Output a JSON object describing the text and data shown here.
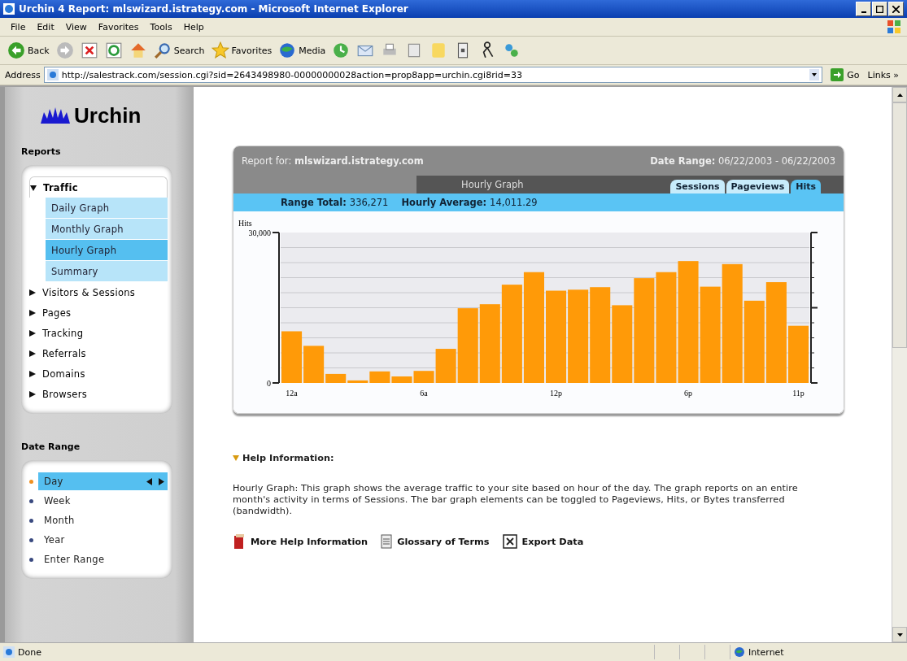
{
  "window": {
    "title": "Urchin 4 Report: mlswizard.istrategy.com - Microsoft Internet Explorer"
  },
  "menu": [
    "File",
    "Edit",
    "View",
    "Favorites",
    "Tools",
    "Help"
  ],
  "toolbar": [
    {
      "kind": "back",
      "label": "Back"
    },
    {
      "kind": "forward"
    },
    {
      "kind": "stop"
    },
    {
      "kind": "refresh"
    },
    {
      "kind": "home"
    },
    {
      "kind": "search",
      "label": "Search"
    },
    {
      "kind": "favorites",
      "label": "Favorites"
    },
    {
      "kind": "media",
      "label": "Media"
    },
    {
      "kind": "history"
    },
    {
      "kind": "mail"
    },
    {
      "kind": "print"
    },
    {
      "kind": "edit"
    },
    {
      "kind": "note"
    },
    {
      "kind": "phone"
    },
    {
      "kind": "messenger"
    },
    {
      "kind": "network"
    }
  ],
  "address": {
    "label": "Address",
    "url": "http://salestrack.com/session.cgi?sid=2643498980-00000000028action=prop8app=urchin.cgi8rid=33",
    "go": "Go",
    "links": "Links »"
  },
  "sidebar": {
    "logo": "Urchin",
    "reports_title": "Reports",
    "reports": [
      {
        "label": "Traffic",
        "expanded": true,
        "children": [
          {
            "label": "Daily Graph",
            "selected": false
          },
          {
            "label": "Monthly Graph",
            "selected": false
          },
          {
            "label": "Hourly Graph",
            "selected": true
          },
          {
            "label": "Summary",
            "selected": false
          }
        ]
      },
      {
        "label": "Visitors & Sessions",
        "expanded": false
      },
      {
        "label": "Pages",
        "expanded": false
      },
      {
        "label": "Tracking",
        "expanded": false
      },
      {
        "label": "Referrals",
        "expanded": false
      },
      {
        "label": "Domains",
        "expanded": false
      },
      {
        "label": "Browsers",
        "expanded": false
      }
    ],
    "date_range_title": "Date Range",
    "date_range": [
      {
        "label": "Day",
        "selected": true
      },
      {
        "label": "Week",
        "selected": false
      },
      {
        "label": "Month",
        "selected": false
      },
      {
        "label": "Year",
        "selected": false
      },
      {
        "label": "Enter Range",
        "selected": false
      }
    ]
  },
  "report": {
    "report_for_label": "Report for:",
    "site": "mlswizard.istrategy.com",
    "date_range_label": "Date Range:",
    "date_range": "06/22/2003 - 06/22/2003",
    "view_title": "Hourly Graph",
    "tabs": [
      {
        "label": "Sessions",
        "selected": false
      },
      {
        "label": "Pageviews",
        "selected": false
      },
      {
        "label": "Hits",
        "selected": true
      }
    ],
    "range_total_label": "Range Total:",
    "range_total": "336,271",
    "hourly_average_label": "Hourly Average:",
    "hourly_average": "14,011.29",
    "chart_data": {
      "type": "bar",
      "ylabel": "Hits",
      "categories": [
        "12a",
        null,
        null,
        null,
        null,
        null,
        "6a",
        null,
        null,
        null,
        null,
        null,
        "12p",
        null,
        null,
        null,
        null,
        null,
        "6p",
        null,
        null,
        null,
        null,
        "11p"
      ],
      "values": [
        10300,
        7400,
        1800,
        500,
        2300,
        1300,
        2400,
        6800,
        14900,
        15700,
        19600,
        22100,
        18400,
        18600,
        19100,
        15500,
        20900,
        22100,
        24300,
        19200,
        23700,
        16400,
        20100,
        11400
      ],
      "ylim": [
        0,
        30000
      ],
      "yticks": [
        {
          "value": 0,
          "label": "0"
        },
        {
          "value": 30000,
          "label": "30,000"
        }
      ]
    }
  },
  "help": {
    "title": "Help Information:",
    "text": "Hourly Graph: This graph shows the average traffic to your site based on hour of the day. The graph reports on an entire month's activity in terms of Sessions. The bar graph elements can be toggled to Pageviews, Hits, or Bytes transferred (bandwidth).",
    "links": [
      {
        "kind": "book",
        "label": "More Help Information"
      },
      {
        "kind": "doc",
        "label": "Glossary of Terms"
      },
      {
        "kind": "export",
        "label": "Export Data"
      }
    ]
  },
  "status_bar": {
    "text": "Done",
    "zone": "Internet"
  }
}
